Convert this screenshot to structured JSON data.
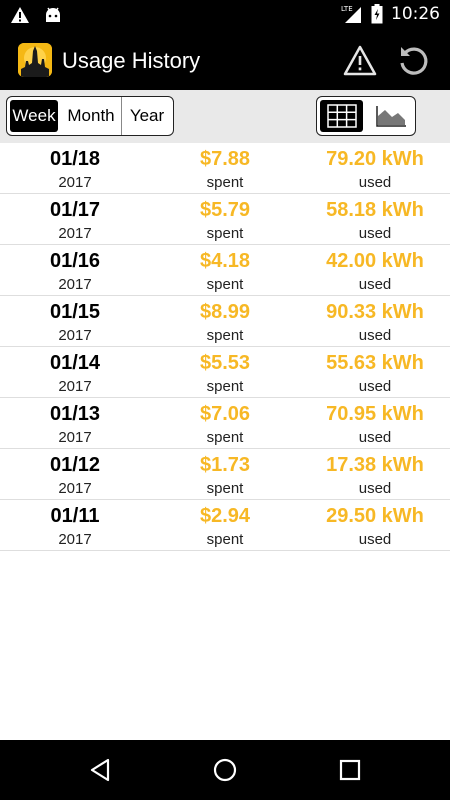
{
  "status_bar": {
    "clock": "10:26",
    "network": "LTE"
  },
  "app_bar": {
    "title": "Usage History"
  },
  "period_tabs": [
    {
      "label": "Week",
      "active": true
    },
    {
      "label": "Month",
      "active": false
    },
    {
      "label": "Year",
      "active": false
    }
  ],
  "view_toggle": {
    "selected": "table"
  },
  "colors": {
    "accent": "#f7b825",
    "bar_bg": "#000000",
    "toolbar_bg": "#e9e9e9"
  },
  "rows": [
    {
      "date": "01/18",
      "year": "2017",
      "cost": "$7.88",
      "spent_label": "spent",
      "kwh": "79.20 kWh",
      "used_label": "used"
    },
    {
      "date": "01/17",
      "year": "2017",
      "cost": "$5.79",
      "spent_label": "spent",
      "kwh": "58.18 kWh",
      "used_label": "used"
    },
    {
      "date": "01/16",
      "year": "2017",
      "cost": "$4.18",
      "spent_label": "spent",
      "kwh": "42.00 kWh",
      "used_label": "used"
    },
    {
      "date": "01/15",
      "year": "2017",
      "cost": "$8.99",
      "spent_label": "spent",
      "kwh": "90.33 kWh",
      "used_label": "used"
    },
    {
      "date": "01/14",
      "year": "2017",
      "cost": "$5.53",
      "spent_label": "spent",
      "kwh": "55.63 kWh",
      "used_label": "used"
    },
    {
      "date": "01/13",
      "year": "2017",
      "cost": "$7.06",
      "spent_label": "spent",
      "kwh": "70.95 kWh",
      "used_label": "used"
    },
    {
      "date": "01/12",
      "year": "2017",
      "cost": "$1.73",
      "spent_label": "spent",
      "kwh": "17.38 kWh",
      "used_label": "used"
    },
    {
      "date": "01/11",
      "year": "2017",
      "cost": "$2.94",
      "spent_label": "spent",
      "kwh": "29.50 kWh",
      "used_label": "used"
    }
  ]
}
